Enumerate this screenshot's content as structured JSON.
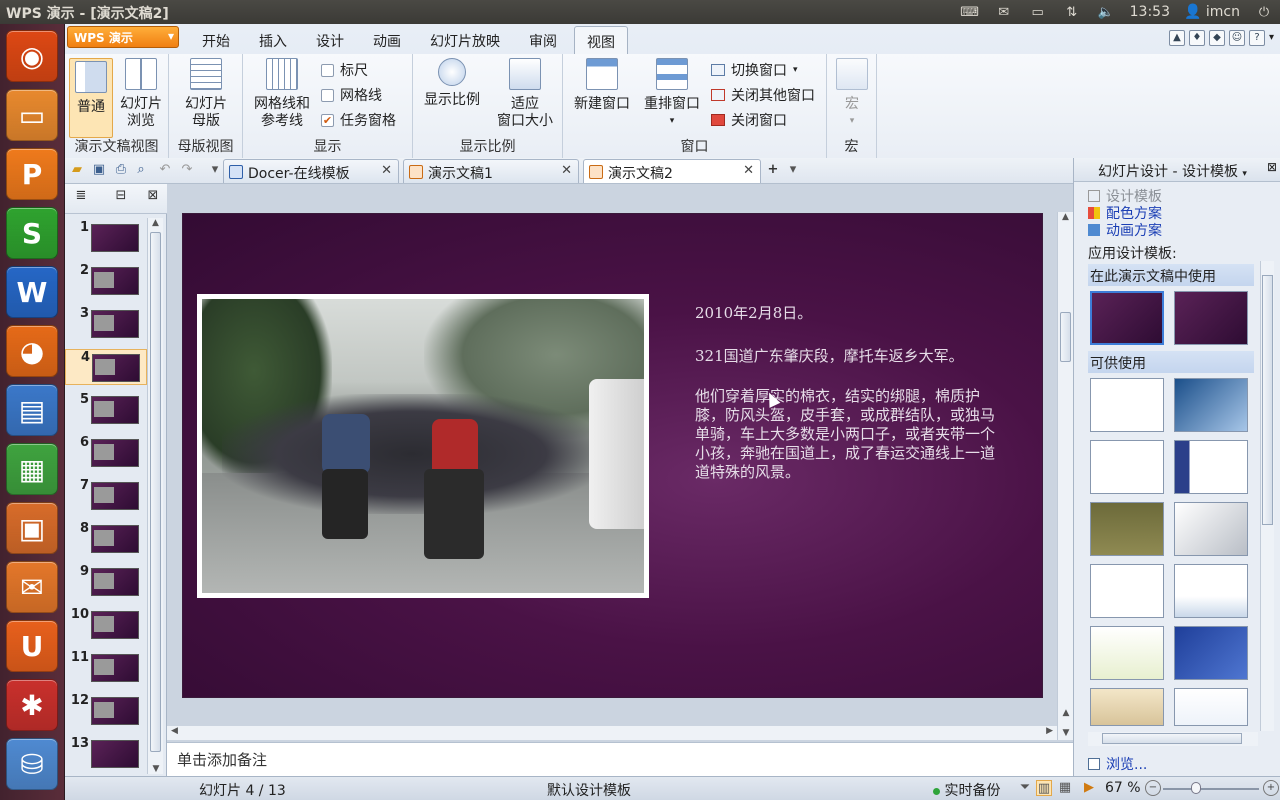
{
  "window": {
    "title": "WPS 演示 - [演示文稿2]"
  },
  "tray": {
    "clock": "13:53",
    "user": "imcn"
  },
  "launcher": [
    {
      "name": "ubuntu-home-icon",
      "color": "#dd4814",
      "glyph": "◉"
    },
    {
      "name": "files-icon",
      "color": "#e8892e",
      "glyph": "▭"
    },
    {
      "name": "wps-presentation-icon",
      "color": "#ef7a1c",
      "glyph": "P"
    },
    {
      "name": "wps-spreadsheet-icon",
      "color": "#2fa32f",
      "glyph": "S"
    },
    {
      "name": "wps-writer-icon",
      "color": "#2667c6",
      "glyph": "W"
    },
    {
      "name": "firefox-icon",
      "color": "#e66a18",
      "glyph": "◕"
    },
    {
      "name": "writer-icon",
      "color": "#3b78c9",
      "glyph": "▤"
    },
    {
      "name": "calc-icon",
      "color": "#3fa33f",
      "glyph": "▦"
    },
    {
      "name": "impress-icon",
      "color": "#d86c2a",
      "glyph": "▣"
    },
    {
      "name": "software-center-icon",
      "color": "#e4772a",
      "glyph": "✉"
    },
    {
      "name": "ubuntu-one-icon",
      "color": "#e8601c",
      "glyph": "U"
    },
    {
      "name": "system-settings-icon",
      "color": "#c9302c",
      "glyph": "✱"
    },
    {
      "name": "disk-icon",
      "color": "#4f8ad1",
      "glyph": "⛁"
    }
  ],
  "ribbon": {
    "app_button": "WPS 演示",
    "tabs": [
      "开始",
      "插入",
      "设计",
      "动画",
      "幻灯片放映",
      "审阅",
      "视图"
    ],
    "active_tab": "视图",
    "groups": {
      "view": {
        "label": "演示文稿视图",
        "normal": "普通",
        "browse_l1": "幻灯片",
        "browse_l2": "浏览"
      },
      "master": {
        "label": "母版视图",
        "btn_l1": "幻灯片",
        "btn_l2": "母版"
      },
      "show": {
        "label": "显示",
        "grid_l1": "网格线和",
        "grid_l2": "参考线",
        "ruler": "标尺",
        "gridlines": "网格线",
        "taskpane": "任务窗格"
      },
      "zoom": {
        "label": "显示比例",
        "zoom": "显示比例",
        "fit_l1": "适应",
        "fit_l2": "窗口大小"
      },
      "window": {
        "label": "窗口",
        "new": "新建窗口",
        "arrange": "重排窗口",
        "switch": "切换窗口",
        "close_other": "关闭其他窗口",
        "close": "关闭窗口"
      },
      "macro": {
        "label": "宏",
        "btn": "宏"
      }
    }
  },
  "doctabs": [
    {
      "label": "Docer-在线模板",
      "active": false
    },
    {
      "label": "演示文稿1",
      "active": false
    },
    {
      "label": "演示文稿2",
      "active": true
    }
  ],
  "thumbnails": [
    "1",
    "2",
    "3",
    "4",
    "5",
    "6",
    "7",
    "8",
    "9",
    "10",
    "11",
    "12",
    "13"
  ],
  "active_slide": 4,
  "slide": {
    "line1": "2010年2月8日。",
    "line2": "321国道广东肇庆段，摩托车返乡大军。",
    "line3": "他们穿着厚实的棉衣，结实的绑腿，棉质护膝，防风头盔，皮手套，或成群结队，或独马单骑，车上大多数是小两口子，或者夹带一个小孩，奔驰在国道上，成了春运交通线上一道道特殊的风景。"
  },
  "notes_placeholder": "单击添加备注",
  "taskpane": {
    "title": "幻灯片设计 - 设计模板",
    "links": [
      "设计模板",
      "配色方案",
      "动画方案"
    ],
    "apply_label": "应用设计模板:",
    "section_used": "在此演示文稿中使用",
    "section_available": "可供使用",
    "browse": "浏览..."
  },
  "status": {
    "slide_info": "幻灯片 4 / 13",
    "template": "默认设计模板",
    "backup": "实时备份",
    "zoom": "67 %"
  }
}
